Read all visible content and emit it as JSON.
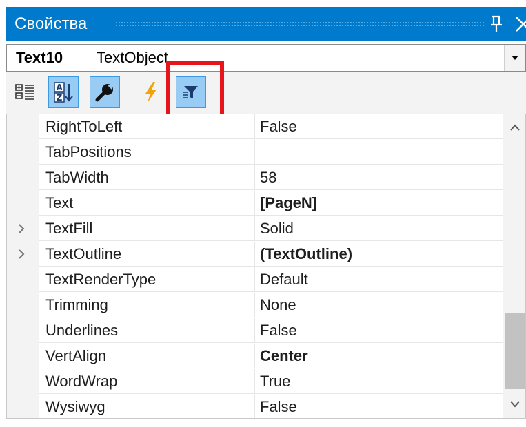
{
  "window": {
    "title": "Свойства",
    "pin_icon": "pin-icon",
    "close_icon": "close-icon"
  },
  "selector": {
    "object_name": "Text10",
    "object_type": "TextObject"
  },
  "toolbar": {
    "buttons": [
      {
        "icon": "categorized-icon",
        "active": false
      },
      {
        "icon": "alphabetical-sort-icon",
        "active": true
      },
      {
        "icon": "properties-wrench-icon",
        "active": true
      },
      {
        "icon": "events-lightning-icon",
        "active": false
      },
      {
        "icon": "filter-icon",
        "active": true
      }
    ],
    "highlight_color": "#e8141b"
  },
  "properties": [
    {
      "name": "RightToLeft",
      "value": "False",
      "bold": false,
      "expandable": false
    },
    {
      "name": "TabPositions",
      "value": "",
      "bold": false,
      "expandable": false
    },
    {
      "name": "TabWidth",
      "value": "58",
      "bold": false,
      "expandable": false
    },
    {
      "name": "Text",
      "value": "[PageN]",
      "bold": true,
      "expandable": false
    },
    {
      "name": "TextFill",
      "value": "Solid",
      "bold": false,
      "expandable": true
    },
    {
      "name": "TextOutline",
      "value": "(TextOutline)",
      "bold": true,
      "expandable": true
    },
    {
      "name": "TextRenderType",
      "value": "Default",
      "bold": false,
      "expandable": false
    },
    {
      "name": "Trimming",
      "value": "None",
      "bold": false,
      "expandable": false
    },
    {
      "name": "Underlines",
      "value": "False",
      "bold": false,
      "expandable": false
    },
    {
      "name": "VertAlign",
      "value": "Center",
      "bold": true,
      "expandable": false
    },
    {
      "name": "WordWrap",
      "value": "True",
      "bold": false,
      "expandable": false
    },
    {
      "name": "Wysiwyg",
      "value": "False",
      "bold": false,
      "expandable": false
    }
  ],
  "colors": {
    "titlebar": "#007acc",
    "active_button": "#99ccf5",
    "gutter": "#f3f3f3"
  }
}
